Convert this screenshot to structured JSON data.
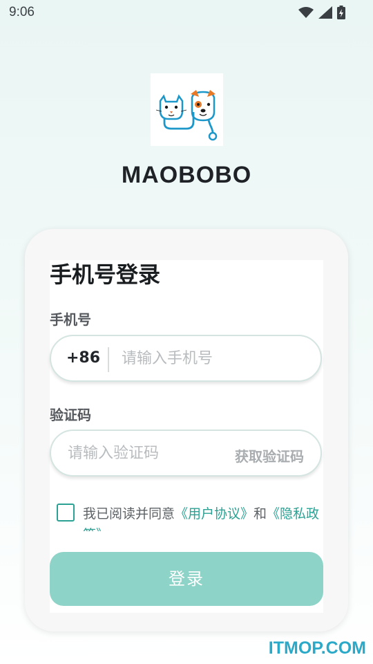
{
  "status_bar": {
    "time": "9:06",
    "icons": [
      "wifi-icon",
      "signal-icon",
      "battery-charging-icon"
    ]
  },
  "app": {
    "name": "MAOBOBO",
    "logo_icon": "cat-dog-stethoscope-logo"
  },
  "login": {
    "title": "手机号登录",
    "phone_label": "手机号",
    "country_code": "+86",
    "phone_placeholder": "请输入手机号",
    "phone_value": "",
    "code_label": "验证码",
    "code_placeholder": "请输入验证码",
    "code_value": "",
    "get_code_label": "获取验证码",
    "agreement": {
      "checked": false,
      "prefix": "我已阅读并同意",
      "user_agreement": "《用户协议》",
      "conjunction": "和",
      "privacy_policy": "《隐私政策》"
    },
    "submit_label": "登录"
  },
  "watermark": "ITMOP.COM",
  "colors": {
    "accent": "#2aa193",
    "button_disabled": "#8dd3c7",
    "watermark": "#2aa9c8"
  }
}
